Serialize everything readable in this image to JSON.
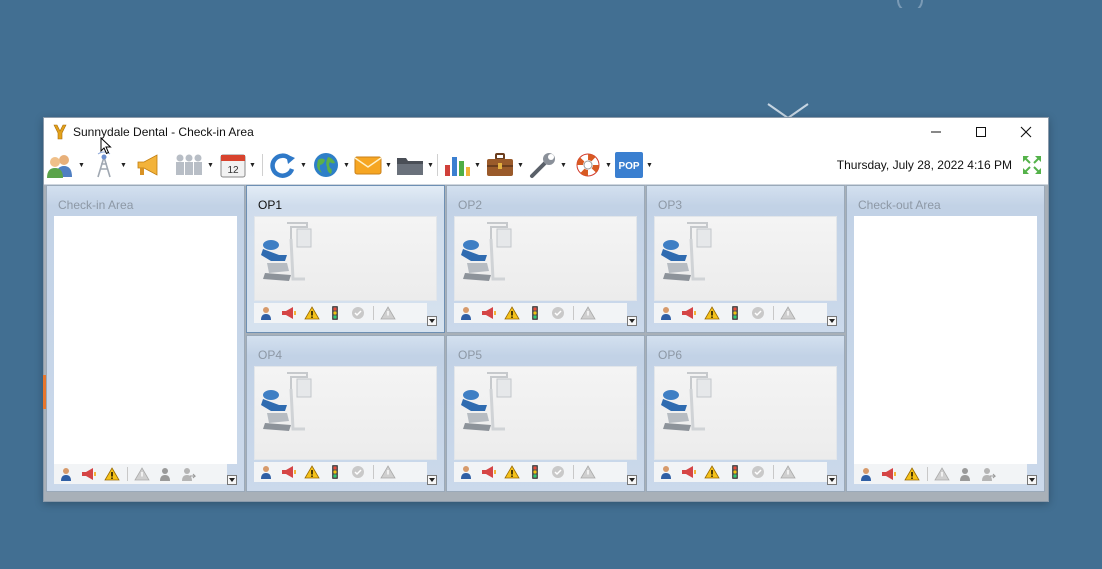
{
  "window": {
    "title": "Sunnydale Dental - Check-in Area",
    "controls": {
      "minimize": "minimize",
      "maximize": "maximize",
      "close": "close"
    }
  },
  "toolbar": {
    "items": [
      {
        "icon": "patients-icon",
        "dropdown": true
      },
      {
        "icon": "antenna-icon",
        "dropdown": true
      },
      {
        "icon": "megaphone-icon",
        "dropdown": false
      },
      {
        "icon": "staff-icon",
        "dropdown": true
      },
      {
        "icon": "calendar-icon",
        "dropdown": true,
        "text": "12"
      },
      {
        "icon": "refresh-icon",
        "dropdown": true
      },
      {
        "icon": "globe-icon",
        "dropdown": true
      },
      {
        "icon": "mail-icon",
        "dropdown": true
      },
      {
        "icon": "folder-icon",
        "dropdown": true
      },
      {
        "icon": "chart-icon",
        "dropdown": true
      },
      {
        "icon": "briefcase-icon",
        "dropdown": true
      },
      {
        "icon": "wrench-icon",
        "dropdown": true
      },
      {
        "icon": "lifebuoy-icon",
        "dropdown": true
      },
      {
        "icon": "pop-icon",
        "dropdown": true,
        "text": "POP"
      }
    ],
    "datetime": "Thursday, July 28, 2022 4:16 PM"
  },
  "areas": {
    "checkin": {
      "title": "Check-in Area"
    },
    "checkout": {
      "title": "Check-out Area"
    }
  },
  "operatories": [
    {
      "label": "OP1",
      "selected": true
    },
    {
      "label": "OP2",
      "selected": false
    },
    {
      "label": "OP3",
      "selected": false
    },
    {
      "label": "OP4",
      "selected": false
    },
    {
      "label": "OP5",
      "selected": false
    },
    {
      "label": "OP6",
      "selected": false
    }
  ],
  "colors": {
    "desktop": "#426f92",
    "panel": "#c2d2e6",
    "accent_orange": "#e6762d",
    "pop_blue": "#3a7fd0"
  }
}
